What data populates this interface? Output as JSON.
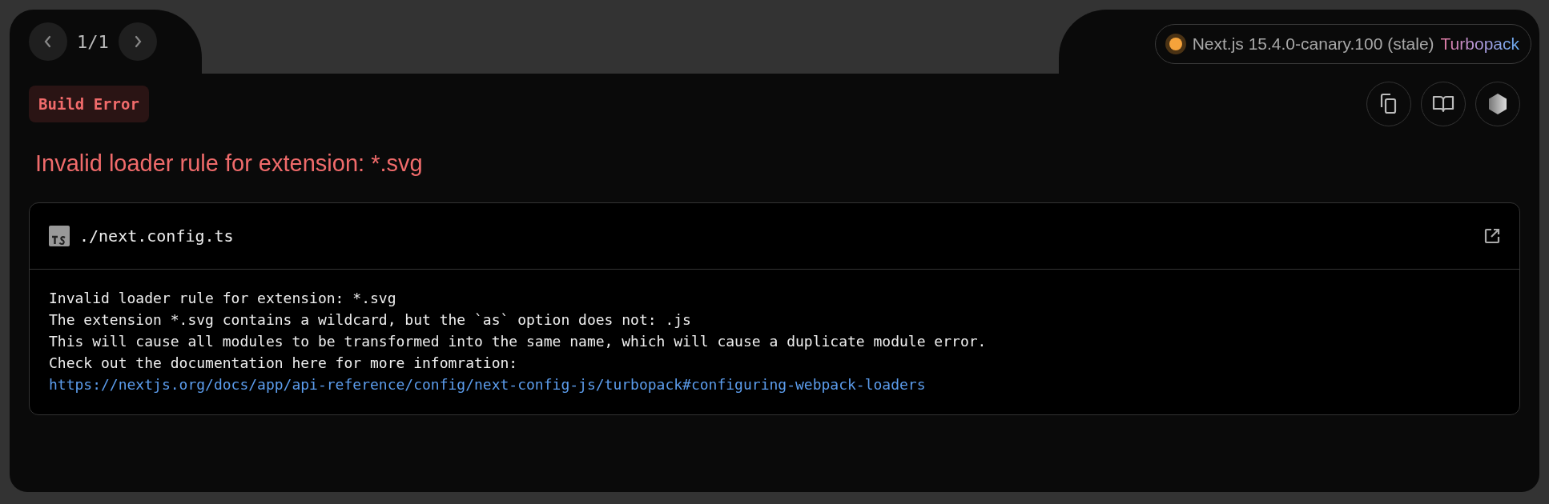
{
  "pager": {
    "label": "1/1"
  },
  "version_badge": {
    "version": "Next.js 15.4.0-canary.100 (stale)",
    "bundler": "Turbopack"
  },
  "error_label": "Build Error",
  "error_title": "Invalid loader rule for extension: *.svg",
  "code_frame": {
    "file": "./next.config.ts",
    "lines": [
      "Invalid loader rule for extension: *.svg",
      "The extension *.svg contains a wildcard, but the `as` option does not: .js",
      "This will cause all modules to be transformed into the same name, which will cause a duplicate module error.",
      "Check out the documentation here for more infomration:"
    ],
    "link": "https://nextjs.org/docs/app/api-reference/config/next-config-js/turbopack#configuring-webpack-loaders"
  }
}
